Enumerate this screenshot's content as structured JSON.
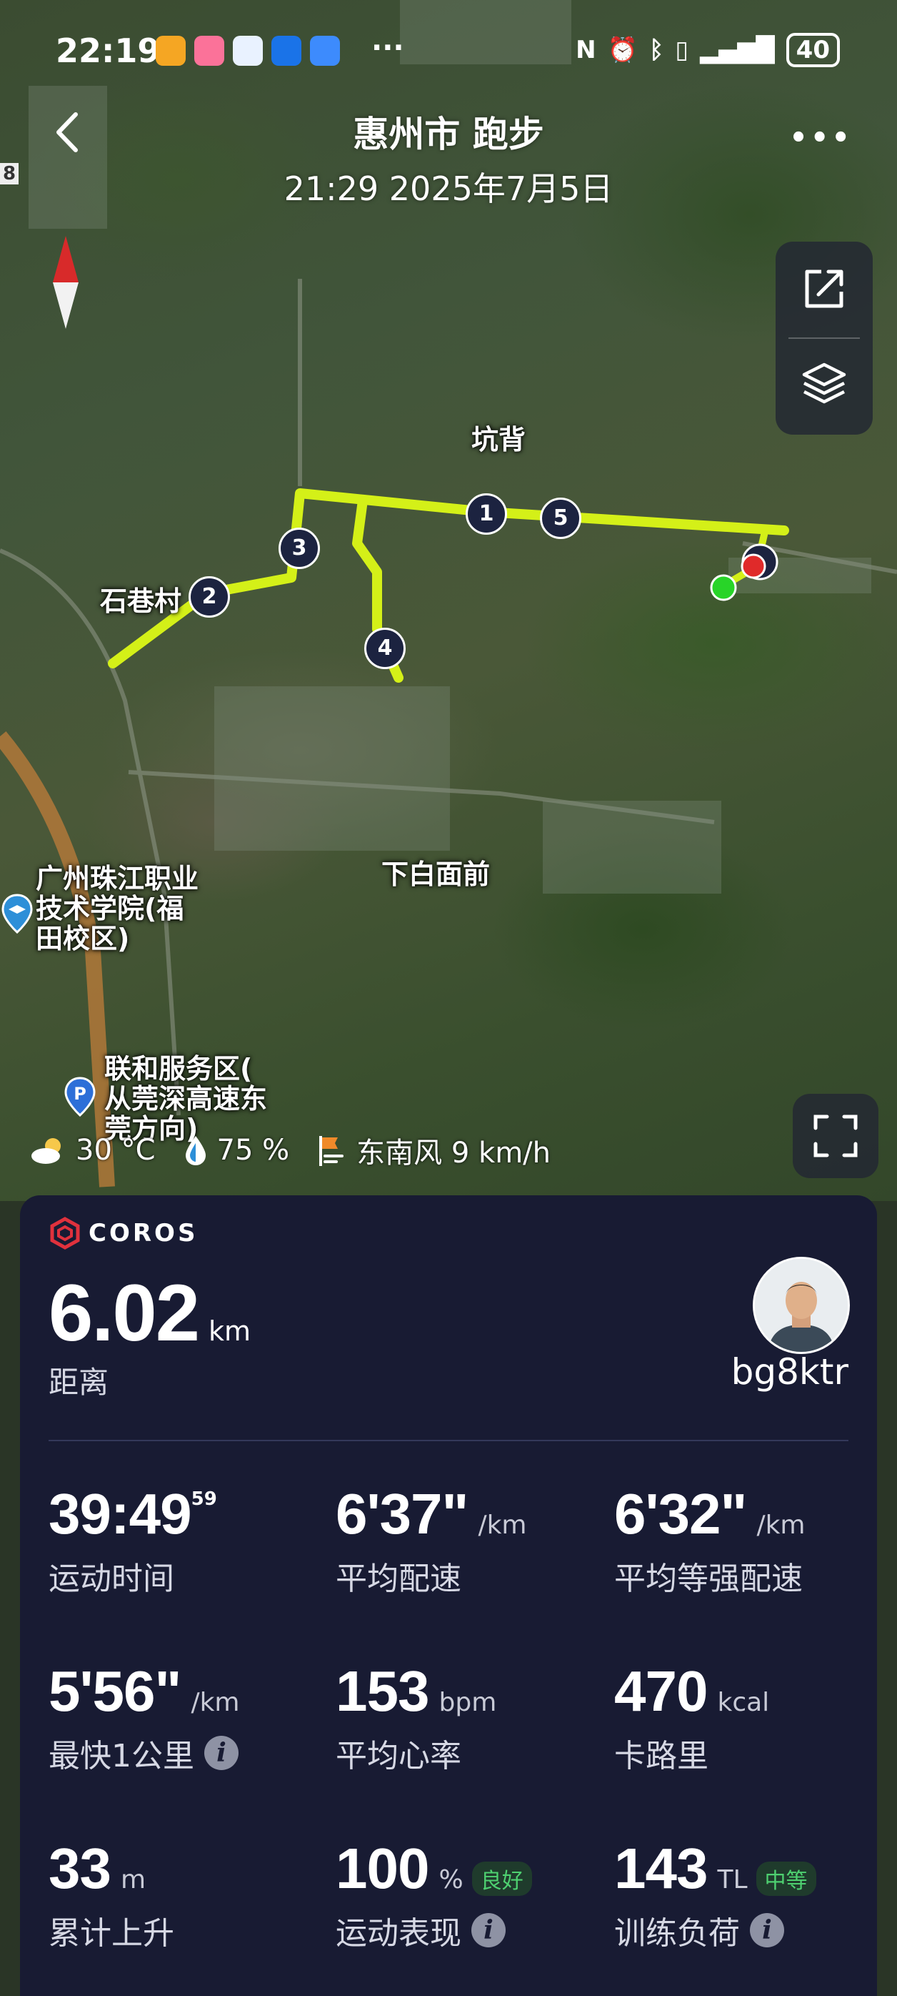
{
  "status_bar": {
    "time": "22:19",
    "more": "···",
    "battery": "40"
  },
  "header": {
    "title": "惠州市 跑步",
    "subtitle": "21:29 2025年7月5日",
    "more": "•••"
  },
  "map": {
    "places": [
      "坑背",
      "石巷村",
      "下白面前",
      "广州珠江职业\n技术学院(福\n田校区)",
      "联和服务区(\n从莞深高速东\n莞方向)"
    ],
    "laps": [
      "1",
      "2",
      "3",
      "4",
      "5"
    ],
    "route_color": "#d4f018",
    "side_label": "8"
  },
  "weather": {
    "temp": "30 °C",
    "humidity": "75 %",
    "wind": "东南风 9 km/h"
  },
  "card": {
    "brand": "COROS",
    "distance": {
      "value": "6.02",
      "unit": "km",
      "label": "距离"
    },
    "user": {
      "name": "bg8ktr"
    },
    "stats": [
      {
        "value": "39:49",
        "sup": "59",
        "unit": "",
        "label": "运动时间"
      },
      {
        "value": "6'37\"",
        "unit": "/km",
        "label": "平均配速"
      },
      {
        "value": "6'32\"",
        "unit": "/km",
        "label": "平均等强配速"
      },
      {
        "value": "5'56\"",
        "unit": "/km",
        "label": "最快1公里"
      },
      {
        "value": "153",
        "unit": "bpm",
        "label": "平均心率"
      },
      {
        "value": "470",
        "unit": "kcal",
        "label": "卡路里"
      },
      {
        "value": "33",
        "unit": "m",
        "label": "累计上升"
      },
      {
        "value": "100",
        "unit": "%",
        "badge": "良好",
        "label": "运动表现"
      },
      {
        "value": "143",
        "unit": "TL",
        "badge": "中等",
        "label": "训练负荷"
      }
    ],
    "info_icon": "i"
  }
}
